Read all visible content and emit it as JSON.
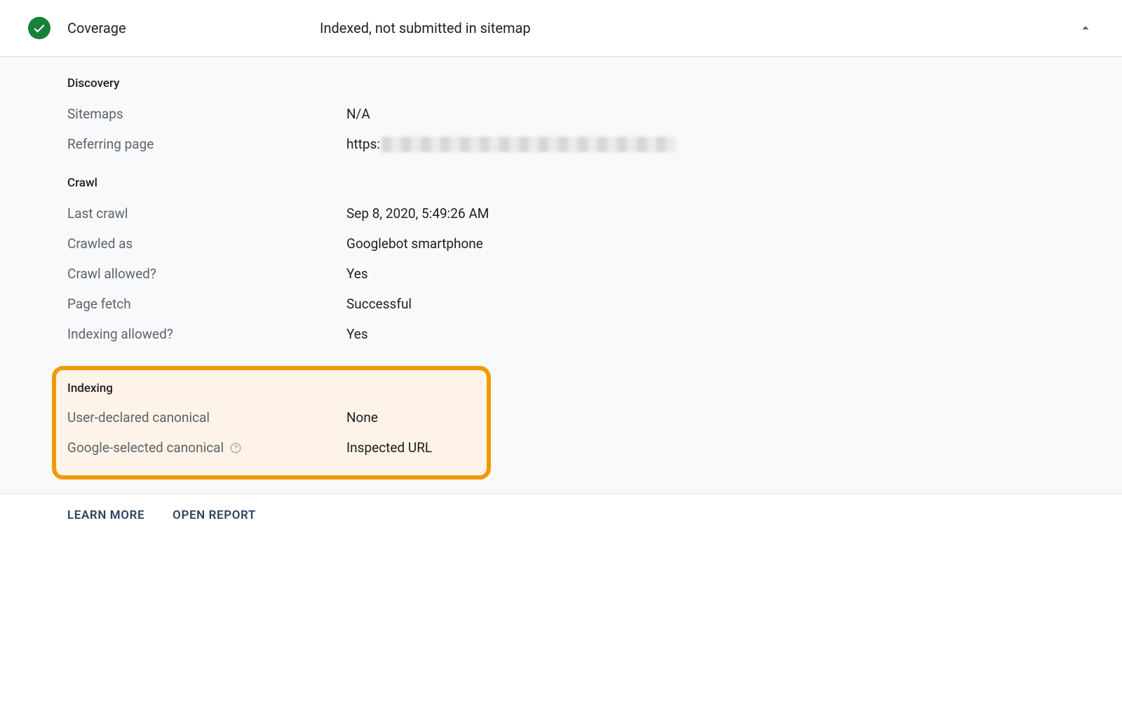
{
  "header": {
    "title": "Coverage",
    "summary": "Indexed, not submitted in sitemap"
  },
  "sections": {
    "discovery": {
      "title": "Discovery",
      "sitemaps_label": "Sitemaps",
      "sitemaps_value": "N/A",
      "referring_label": "Referring page",
      "referring_prefix": "https:"
    },
    "crawl": {
      "title": "Crawl",
      "last_crawl_label": "Last crawl",
      "last_crawl_value": "Sep 8, 2020, 5:49:26 AM",
      "crawled_as_label": "Crawled as",
      "crawled_as_value": "Googlebot smartphone",
      "crawl_allowed_label": "Crawl allowed?",
      "crawl_allowed_value": "Yes",
      "page_fetch_label": "Page fetch",
      "page_fetch_value": "Successful",
      "indexing_allowed_label": "Indexing allowed?",
      "indexing_allowed_value": "Yes"
    },
    "indexing": {
      "title": "Indexing",
      "user_canonical_label": "User-declared canonical",
      "user_canonical_value": "None",
      "google_canonical_label": "Google-selected canonical",
      "google_canonical_value": "Inspected URL"
    }
  },
  "footer": {
    "learn_more": "Learn More",
    "open_report": "Open Report"
  }
}
